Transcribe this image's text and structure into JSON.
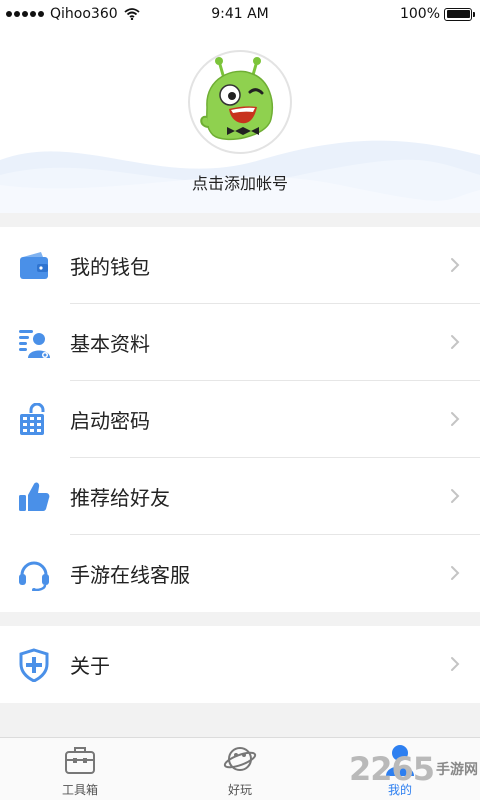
{
  "status_bar": {
    "carrier": "Qihoo360",
    "time": "9:41 AM",
    "battery": "100%"
  },
  "profile": {
    "add_account_label": "点击添加帐号",
    "avatar_icon": "alien-mascot-icon"
  },
  "menu": {
    "group1": [
      {
        "label": "我的钱包",
        "icon": "wallet-icon"
      },
      {
        "label": "基本资料",
        "icon": "profile-info-icon"
      },
      {
        "label": "启动密码",
        "icon": "keypad-lock-icon"
      },
      {
        "label": "推荐给好友",
        "icon": "thumbs-up-icon"
      },
      {
        "label": "手游在线客服",
        "icon": "headset-icon"
      }
    ],
    "group2": [
      {
        "label": "关于",
        "icon": "shield-plus-icon"
      }
    ]
  },
  "tabs": [
    {
      "label": "工具箱",
      "icon": "toolbox-icon",
      "active": false
    },
    {
      "label": "好玩",
      "icon": "planet-icon",
      "active": false
    },
    {
      "label": "我的",
      "icon": "user-icon",
      "active": true
    }
  ],
  "watermark": {
    "number": "2265",
    "text": "手游网"
  },
  "colors": {
    "accent": "#2d7ff0",
    "icon_blue": "#4a90e8",
    "background": "#f2f2f2"
  }
}
